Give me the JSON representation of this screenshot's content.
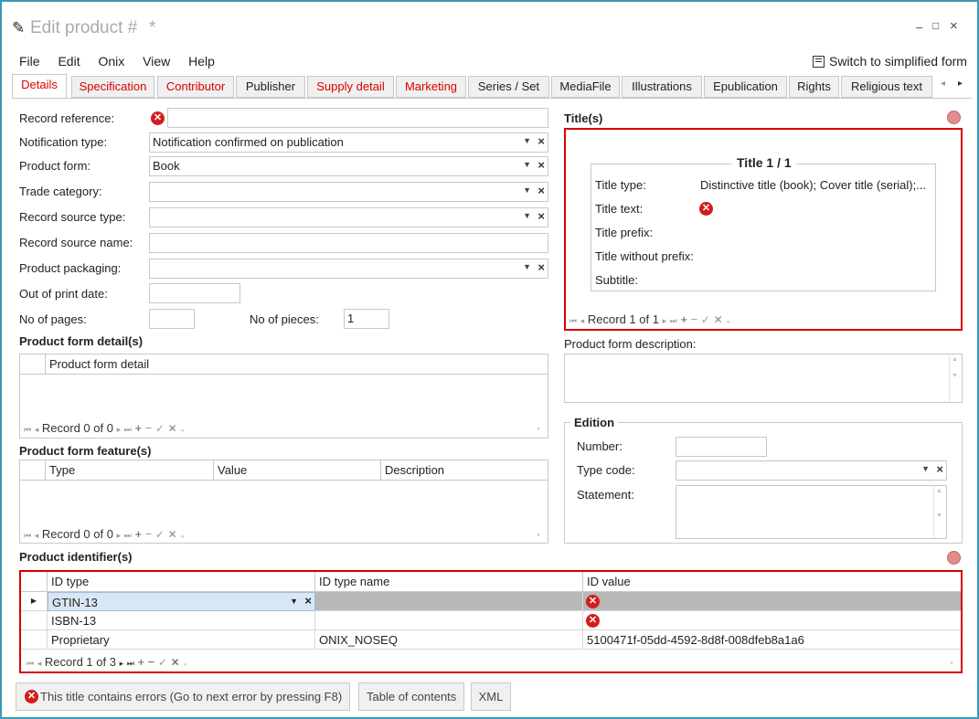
{
  "window": {
    "title": "Edit product #",
    "modified_marker": "*",
    "minimize": "–",
    "maximize": "□",
    "close": "×"
  },
  "menu": {
    "file": "File",
    "edit": "Edit",
    "onix": "Onix",
    "view": "View",
    "help": "Help",
    "switch_label": "Switch to simplified form"
  },
  "tabs": [
    "Details",
    "Specification",
    "Contributor",
    "Publisher",
    "Supply detail",
    "Marketing",
    "Series / Set",
    "MediaFile",
    "Illustrations",
    "Epublication",
    "Rights",
    "Religious text"
  ],
  "tab_nav": {
    "prev": "◂",
    "next": "▸"
  },
  "fields": {
    "record_reference": {
      "label": "Record reference:",
      "value": ""
    },
    "notification_type": {
      "label": "Notification type:",
      "value": "Notification confirmed on publication"
    },
    "product_form": {
      "label": "Product form:",
      "value": "Book"
    },
    "trade_category": {
      "label": "Trade category:",
      "value": ""
    },
    "record_source_type": {
      "label": "Record source type:",
      "value": ""
    },
    "record_source_name": {
      "label": "Record source name:",
      "value": ""
    },
    "product_packaging": {
      "label": "Product packaging:",
      "value": ""
    },
    "out_of_print_date": {
      "label": "Out of print date:",
      "value": ""
    },
    "no_of_pages": {
      "label": "No of pages:",
      "value": ""
    },
    "no_of_pieces": {
      "label": "No of pieces:",
      "value": "1"
    }
  },
  "product_form_detail": {
    "title": "Product form detail(s)",
    "header": "Product form detail",
    "nav_text": "Record 0 of 0"
  },
  "product_form_feature": {
    "title": "Product form feature(s)",
    "headers": [
      "Type",
      "Value",
      "Description"
    ],
    "nav_text": "Record 0 of 0"
  },
  "titles": {
    "section": "Title(s)",
    "group_title": "Title 1 / 1",
    "title_type_label": "Title type:",
    "title_type_value": "Distinctive title (book); Cover title (serial);...",
    "title_text_label": "Title text:",
    "title_prefix_label": "Title prefix:",
    "title_without_prefix_label": "Title without prefix:",
    "subtitle_label": "Subtitle:",
    "nav_text": "Record 1 of 1"
  },
  "product_form_description": {
    "label": "Product form description:",
    "value": ""
  },
  "edition": {
    "title": "Edition",
    "number_label": "Number:",
    "type_code_label": "Type code:",
    "statement_label": "Statement:"
  },
  "identifiers": {
    "title": "Product identifier(s)",
    "headers": [
      "ID type",
      "ID type name",
      "ID value"
    ],
    "rows": [
      {
        "type": "GTIN-13",
        "type_name": "",
        "value": ""
      },
      {
        "type": "ISBN-13",
        "type_name": "",
        "value": ""
      },
      {
        "type": "Proprietary",
        "type_name": "ONIX_NOSEQ",
        "value": "5100471f-05dd-4592-8d8f-008dfeb8a1a6"
      }
    ],
    "nav_text": "Record 1 of 3"
  },
  "nav_symbols": {
    "first": "⏮",
    "prev": "◂",
    "next": "▸",
    "last": "⏭",
    "add": "+",
    "remove": "−",
    "confirm": "✓",
    "cancel": "✕",
    "scroll": "◂"
  },
  "bottom": {
    "errors_button": "This title contains errors (Go to next error by pressing F8)",
    "toc_button": "Table of contents",
    "xml_button": "XML"
  },
  "colors": {
    "error": "#d90000",
    "accent": "#3b9ab4",
    "selected_row": "#d9e7f5"
  }
}
